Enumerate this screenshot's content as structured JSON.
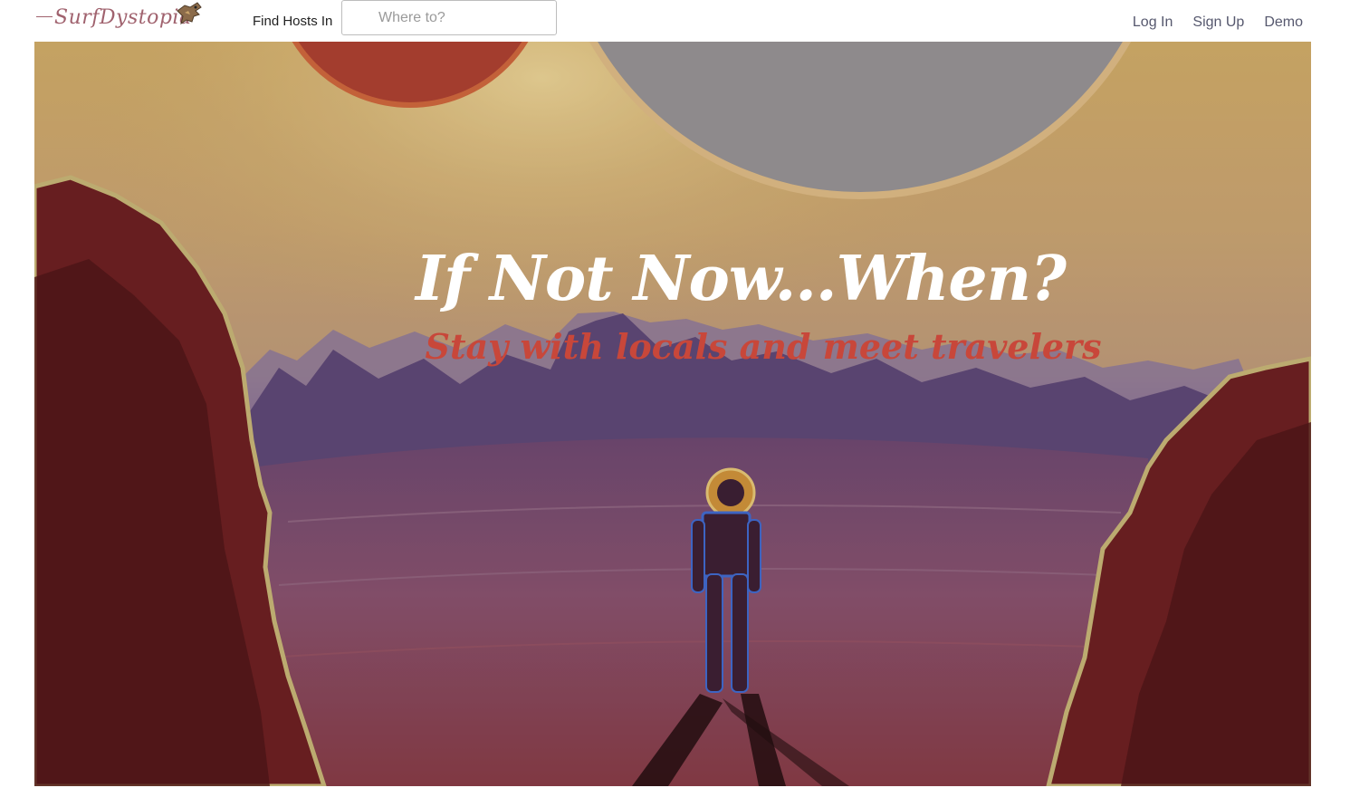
{
  "nav": {
    "brand": "SurfDystopia",
    "find_label": "Find Hosts In",
    "search_placeholder": "Where to?",
    "links": {
      "login": "Log In",
      "signup": "Sign Up",
      "demo": "Demo"
    }
  },
  "hero": {
    "headline": "If Not Now...When?",
    "subheadline": "Stay with locals and meet travelers"
  },
  "colors": {
    "brand": "#a0626e",
    "nav_link": "#56586e",
    "subheadline": "#c8473a",
    "headline": "#ffffff"
  },
  "icons": {
    "mascot": "flying-creature-logo-icon"
  }
}
